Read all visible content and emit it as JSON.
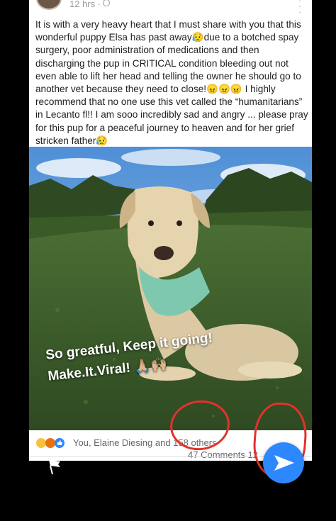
{
  "post": {
    "time": "12 hrs ·",
    "text": "It is with a very heavy heart that I must share with you that this wonderful puppy Elsa has past away😥due to a botched spay surgery, poor administration of medications and then discharging the pup in CRITICAL condition bleeding out not even able to lift her head and telling the owner he should go to another vet because they need to close!😠😠😠 I highly recommend that no one use this vet called the “humanitarians” in Lecanto fl!! I am sooo incredibly sad and angry ... please pray for this pup for a peaceful journey to heaven and for her grief stricken father😥",
    "image_overlay": "So greatful, Keep it going!\nMake.It.Viral! 🙏🏼🙌🏼"
  },
  "footer": {
    "reactions_text": "You, Elaine Diesing and 158 others",
    "comments_text": "47 Comments  12"
  },
  "colors": {
    "accent": "#2d88ff",
    "annotation": "#e2322b",
    "bandana": "#7fc8b0",
    "grass": "#3d5e2a"
  },
  "icons": {
    "more": "more-icon",
    "globe": "globe-icon",
    "share_fab": "send-arrow-icon",
    "flag": "flag-icon"
  }
}
